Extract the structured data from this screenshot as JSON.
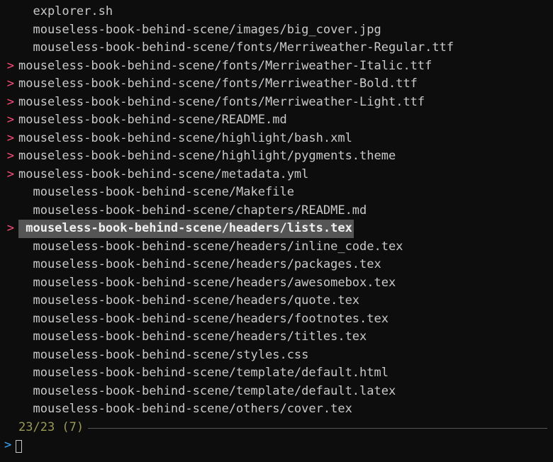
{
  "list": [
    {
      "marker": "",
      "path": "  explorer.sh",
      "selected": false
    },
    {
      "marker": "",
      "path": "  mouseless-book-behind-scene/images/big_cover.jpg",
      "selected": false
    },
    {
      "marker": "",
      "path": "  mouseless-book-behind-scene/fonts/Merriweather-Regular.ttf",
      "selected": false
    },
    {
      "marker": ">",
      "path": "mouseless-book-behind-scene/fonts/Merriweather-Italic.ttf",
      "selected": false
    },
    {
      "marker": ">",
      "path": "mouseless-book-behind-scene/fonts/Merriweather-Bold.ttf",
      "selected": false
    },
    {
      "marker": ">",
      "path": "mouseless-book-behind-scene/fonts/Merriweather-Light.ttf",
      "selected": false
    },
    {
      "marker": ">",
      "path": "mouseless-book-behind-scene/README.md",
      "selected": false
    },
    {
      "marker": ">",
      "path": "mouseless-book-behind-scene/highlight/bash.xml",
      "selected": false
    },
    {
      "marker": ">",
      "path": "mouseless-book-behind-scene/highlight/pygments.theme",
      "selected": false
    },
    {
      "marker": ">",
      "path": "mouseless-book-behind-scene/metadata.yml",
      "selected": false
    },
    {
      "marker": "",
      "path": "  mouseless-book-behind-scene/Makefile",
      "selected": false
    },
    {
      "marker": "",
      "path": "  mouseless-book-behind-scene/chapters/README.md",
      "selected": false
    },
    {
      "marker": ">",
      "path": " mouseless-book-behind-scene/headers/lists.tex",
      "selected": true
    },
    {
      "marker": "",
      "path": "  mouseless-book-behind-scene/headers/inline_code.tex",
      "selected": false
    },
    {
      "marker": "",
      "path": "  mouseless-book-behind-scene/headers/packages.tex",
      "selected": false
    },
    {
      "marker": "",
      "path": "  mouseless-book-behind-scene/headers/awesomebox.tex",
      "selected": false
    },
    {
      "marker": "",
      "path": "  mouseless-book-behind-scene/headers/quote.tex",
      "selected": false
    },
    {
      "marker": "",
      "path": "  mouseless-book-behind-scene/headers/footnotes.tex",
      "selected": false
    },
    {
      "marker": "",
      "path": "  mouseless-book-behind-scene/headers/titles.tex",
      "selected": false
    },
    {
      "marker": "",
      "path": "  mouseless-book-behind-scene/styles.css",
      "selected": false
    },
    {
      "marker": "",
      "path": "  mouseless-book-behind-scene/template/default.html",
      "selected": false
    },
    {
      "marker": "",
      "path": "  mouseless-book-behind-scene/template/default.latex",
      "selected": false
    },
    {
      "marker": "",
      "path": "  mouseless-book-behind-scene/others/cover.tex",
      "selected": false
    }
  ],
  "count_label": "23/23 (7)",
  "prompt_symbol": ">"
}
